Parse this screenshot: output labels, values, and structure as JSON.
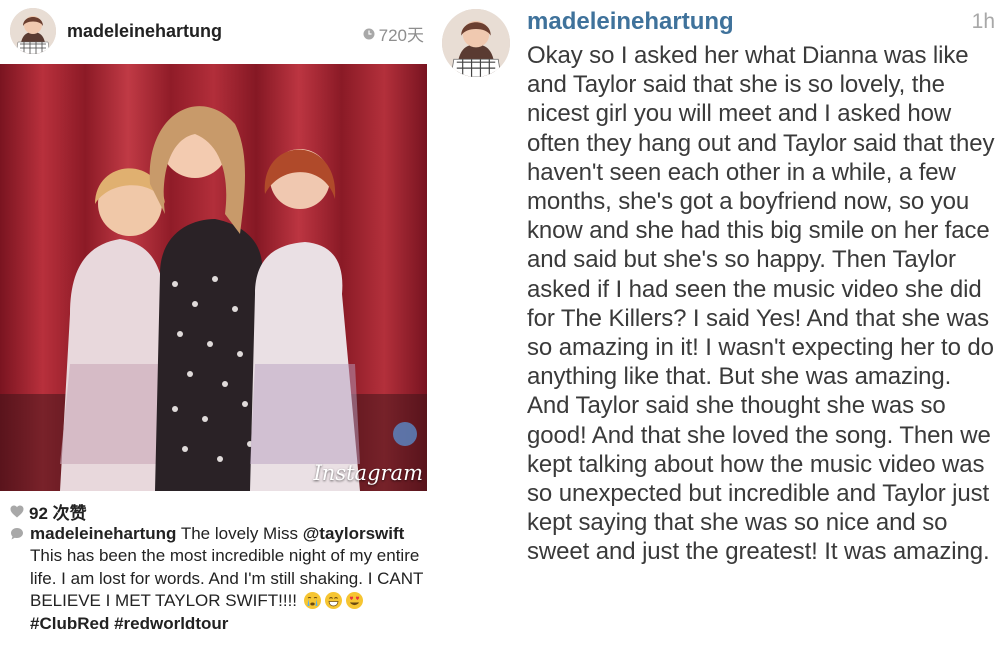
{
  "left_post": {
    "username": "madeleinehartung",
    "time": "720天",
    "likes": "92 次赞",
    "photo_watermark": "Instagram",
    "caption": {
      "username": "madeleinehartung",
      "text_1": " The lovely Miss ",
      "mention": "@taylorswift",
      "text_2": " This has been the most incredible night of my entire life. I am lost for words. And I'm still shaking. I CANT BELIEVE I MET TAYLOR SWIFT!!!! ",
      "hashtag_1": "#ClubRed",
      "hashtag_2": "#redworldtour"
    }
  },
  "right_post": {
    "username": "madeleinehartung",
    "time": "1h",
    "text": "Okay so I asked her what Dianna was like and Taylor said that she is so lovely, the nicest girl you will meet and I asked how often they hang out and Taylor said that they haven't seen each other in a while, a few months, she's got a boyfriend now, so you know and she had this big smile on her face and said but she's so happy. Then Taylor asked if I had seen the music video she did for The Killers? I said Yes! And that she was so amazing in it! I wasn't expecting her to do anything like that. But she was amazing. And Taylor said she thought she was so good! And that she loved the song. Then we kept talking about how the music video was so unexpected but incredible and Taylor just kept saying that she was so nice and so sweet and just the greatest! It was amazing."
  },
  "icons": {
    "clock": "clock-icon",
    "heart": "heart-icon",
    "comment": "comment-bubble-icon",
    "emojis": [
      "crying-face-emoji",
      "grinning-face-emoji",
      "heart-eyes-emoji"
    ]
  },
  "colors": {
    "username_blue": "#3f729b",
    "text_dark": "#222222",
    "meta_gray": "#8e8e8e",
    "photo_curtain_red": "#9e1f2a"
  }
}
